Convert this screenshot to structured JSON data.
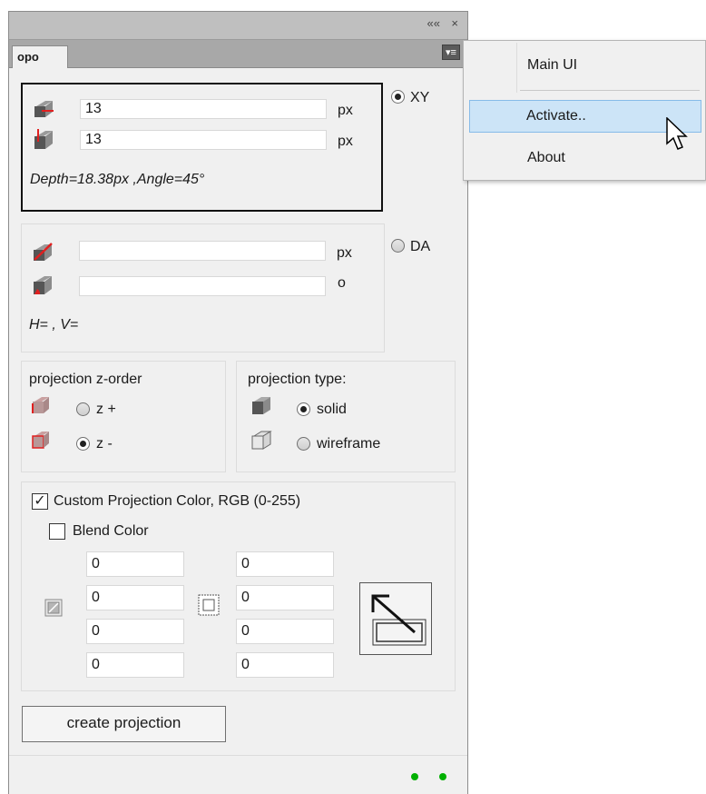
{
  "window": {
    "collapse_glyph": "««",
    "close_glyph": "×"
  },
  "tab": {
    "label": "opo",
    "menu_glyph": "▾≡"
  },
  "xy_group": {
    "h_value": "13",
    "h_unit": "px",
    "v_value": "13",
    "v_unit": "px",
    "summary": "Depth=18.38px ,Angle=45°",
    "radio_label": "XY",
    "selected": true
  },
  "da_group": {
    "depth_value": "",
    "depth_unit": "px",
    "angle_value": "",
    "angle_unit": "o",
    "summary": "H= , V=",
    "radio_label": "DA",
    "selected": false
  },
  "zorder": {
    "title": "projection z-order",
    "options": [
      {
        "label": "z +",
        "selected": false
      },
      {
        "label": "z -",
        "selected": true
      }
    ]
  },
  "ptype": {
    "title": "projection type:",
    "options": [
      {
        "label": "solid",
        "selected": true
      },
      {
        "label": "wireframe",
        "selected": false
      }
    ]
  },
  "color": {
    "custom_label": "Custom Projection Color, RGB (0-255)",
    "custom_checked": true,
    "blend_label": "Blend Color",
    "blend_checked": false,
    "left_values": [
      "0",
      "0",
      "0",
      "0"
    ],
    "right_values": [
      "0",
      "0",
      "0",
      "0"
    ]
  },
  "create_button": "create projection",
  "status_dots": 2,
  "context_menu": {
    "items": [
      {
        "label": "Main UI",
        "highlighted": false
      },
      {
        "label": "Activate..",
        "highlighted": true
      },
      {
        "label": "About",
        "highlighted": false
      }
    ]
  },
  "colors": {
    "accent_red": "#e02020",
    "status_green": "#00b000",
    "menu_highlight": "#cce4f7"
  }
}
